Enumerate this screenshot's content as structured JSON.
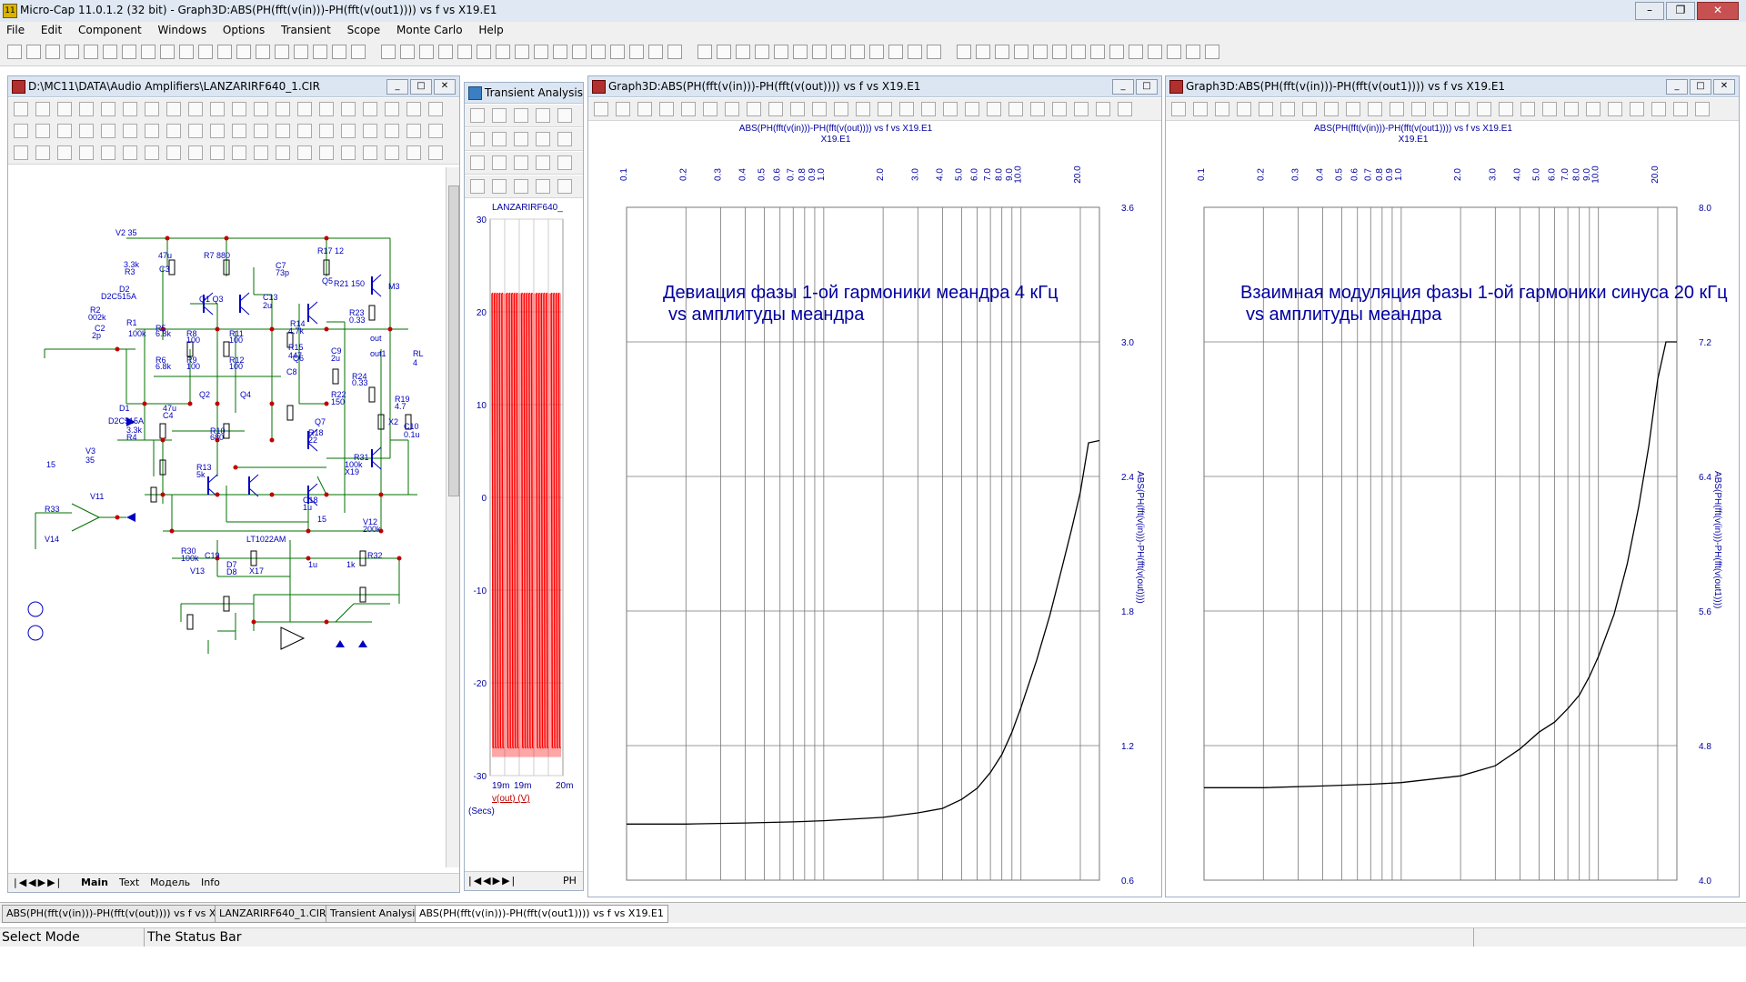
{
  "app": {
    "title": "Micro-Cap 11.0.1.2 (32 bit) - Graph3D:ABS(PH(fft(v(in)))-PH(fft(v(out1)))) vs f vs X19.E1",
    "icon_text": "11"
  },
  "menu": [
    "File",
    "Edit",
    "Component",
    "Windows",
    "Options",
    "Transient",
    "Scope",
    "Monte Carlo",
    "Help"
  ],
  "schematic_window": {
    "title": "D:\\MC11\\DATA\\Audio Amplifiers\\LANZARIRF640_1.CIR",
    "tabs": [
      "Main",
      "Text",
      "Модель",
      "Info"
    ],
    "labels": [
      "V2 35",
      "R7 880",
      "R17 12",
      "47u",
      "3.3k",
      "C3",
      "R3",
      "C7",
      "73p",
      "Q5",
      "D2",
      "Q1 Q3",
      "C13",
      "R21 150",
      "M3",
      "D2C515A",
      "R2",
      "2u",
      "R14",
      "002k",
      "R1",
      "R5",
      "R8",
      "R11",
      "4.7k",
      "R23",
      "0.33",
      "2p",
      "C2",
      "100k",
      "6.8k",
      "100",
      "100",
      "Q6",
      "out",
      "R15",
      "C9",
      "RL",
      "447",
      "2u",
      "4",
      "R6",
      "6.8k",
      "R9",
      "R12",
      "out1",
      "100",
      "100",
      "C8",
      "R24",
      "0.33",
      "Q2",
      "Q4",
      "R22",
      "R19",
      "150",
      "4.7",
      "D1",
      "D2C515A",
      "47u",
      "C4",
      "Q7",
      "X2",
      "C10",
      "3.3k",
      "R10",
      "0.1u",
      "R4",
      "680",
      "R18",
      "22",
      "V3",
      "35",
      "R31",
      "R13",
      "100k",
      "5k",
      "X19",
      "V11",
      "C18",
      "1u",
      "R33",
      "V12",
      "200k",
      "15",
      "V14",
      "R30",
      "100k",
      "C19",
      "R32",
      "D7",
      "D8",
      "1u",
      "1k",
      "V13",
      "X17",
      "15",
      "LT1022AM",
      "in",
      "in1"
    ]
  },
  "transient_window": {
    "title": "Transient Analysis",
    "plot_title": "LANZARIRF640_",
    "y_ticks": [
      "30",
      "20",
      "10",
      "0",
      "-10",
      "-20",
      "-30"
    ],
    "x_ticks": [
      "19m",
      "19m",
      "20m"
    ],
    "trace_label": "v(out) (V)",
    "x_label": "(Secs)",
    "tab_label": "PH",
    "trace_color": "#ff0000",
    "chart_data": {
      "type": "line",
      "title": "LANZARIRF640_",
      "xlabel": "(Secs)",
      "ylabel": "v(out) (V)",
      "ylim": [
        -30,
        30
      ],
      "series": [
        {
          "name": "v(out) (V)",
          "description_values": {
            "high": 22,
            "low": -28
          }
        }
      ],
      "x": [
        "19m",
        "19m",
        "20m"
      ]
    }
  },
  "graph1": {
    "title": "Graph3D:ABS(PH(fft(v(in)))-PH(fft(v(out)))) vs f vs X19.E1",
    "plot_header_1": "ABS(PH(fft(v(in)))-PH(fft(v(out)))) vs f vs X19.E1",
    "plot_header_2": "X19.E1",
    "annotation_1": "Девиация фазы 1-ой гармоники меандра 4 кГц",
    "annotation_2": "vs амплитуды меандра",
    "ylabel": "ABS(PH(fft(v(in)))-PH(fft(v(out))))",
    "x_ticks": [
      "0.1",
      "0.2",
      "0.3",
      "0.4",
      "0.5",
      "0.6",
      "0.7",
      "0.8",
      "0.9",
      "1.0",
      "2.0",
      "3.0",
      "4.0",
      "5.0",
      "6.0",
      "7.0",
      "8.0",
      "9.0",
      "10.0",
      "20.0"
    ],
    "y_ticks": [
      "3.6",
      "3.0",
      "2.4",
      "1.8",
      "1.2",
      "0.6"
    ]
  },
  "graph2": {
    "title": "Graph3D:ABS(PH(fft(v(in)))-PH(fft(v(out1)))) vs f vs X19.E1",
    "plot_header_1": "ABS(PH(fft(v(in)))-PH(fft(v(out1)))) vs f vs X19.E1",
    "plot_header_2": "X19.E1",
    "annotation_1": "Взаимная модуляция фазы 1-ой гармоники синуса 20 кГц",
    "annotation_2": "vs амплитуды меандра",
    "ylabel": "ABS(PH(fft(v(in)))-PH(fft(v(out1))))",
    "x_ticks": [
      "0.1",
      "0.2",
      "0.3",
      "0.4",
      "0.5",
      "0.6",
      "0.7",
      "0.8",
      "0.9",
      "1.0",
      "2.0",
      "3.0",
      "4.0",
      "5.0",
      "6.0",
      "7.0",
      "8.0",
      "9.0",
      "10.0",
      "20.0"
    ],
    "y_ticks": [
      "8.0",
      "7.2",
      "6.4",
      "5.6",
      "4.8",
      "4.0"
    ]
  },
  "chart_data": [
    {
      "type": "line",
      "title": "ABS(PH(fft(v(in)))-PH(fft(v(out)))) vs f vs X19.E1",
      "xlabel": "X19.E1",
      "ylabel": "ABS(PH(fft(v(in)))-PH(fft(v(out))))",
      "xscale": "log",
      "xlim": [
        0.1,
        25
      ],
      "ylim": [
        0.6,
        3.6
      ],
      "grid": true,
      "x": [
        0.1,
        0.2,
        0.4,
        0.7,
        1.0,
        2.0,
        3.0,
        4.0,
        5.0,
        6.0,
        7.0,
        8.0,
        9.0,
        10.0,
        12.0,
        14.0,
        16.0,
        18.0,
        20.0,
        22.0,
        25.0
      ],
      "series": [
        {
          "values": [
            0.85,
            0.85,
            0.855,
            0.86,
            0.865,
            0.88,
            0.9,
            0.92,
            0.96,
            1.01,
            1.08,
            1.16,
            1.26,
            1.37,
            1.58,
            1.78,
            1.98,
            2.16,
            2.33,
            2.55,
            2.56
          ]
        }
      ]
    },
    {
      "type": "line",
      "title": "ABS(PH(fft(v(in)))-PH(fft(v(out1)))) vs f vs X19.E1",
      "xlabel": "X19.E1",
      "ylabel": "ABS(PH(fft(v(in)))-PH(fft(v(out1))))",
      "xscale": "log",
      "xlim": [
        0.1,
        25
      ],
      "ylim": [
        4.0,
        8.0
      ],
      "grid": true,
      "x": [
        0.1,
        0.2,
        0.4,
        0.7,
        1.0,
        2.0,
        3.0,
        4.0,
        5.0,
        6.0,
        7.0,
        8.0,
        9.0,
        10.0,
        12.0,
        14.0,
        16.0,
        18.0,
        20.0,
        22.0,
        25.0
      ],
      "series": [
        {
          "values": [
            4.55,
            4.55,
            4.56,
            4.57,
            4.58,
            4.62,
            4.68,
            4.78,
            4.88,
            4.94,
            5.02,
            5.1,
            5.21,
            5.33,
            5.58,
            5.88,
            6.22,
            6.58,
            6.98,
            7.2,
            7.2
          ]
        }
      ]
    }
  ],
  "taskbar": {
    "tabs": [
      "ABS(PH(fft(v(in)))-PH(fft(v(out)))) vs f vs X19.E1",
      "LANZARIRF640_1.CIR",
      "Transient Analysis",
      "ABS(PH(fft(v(in)))-PH(fft(v(out1)))) vs f vs X19.E1"
    ]
  },
  "status": {
    "mode": "Select Mode",
    "text": "The Status Bar"
  }
}
